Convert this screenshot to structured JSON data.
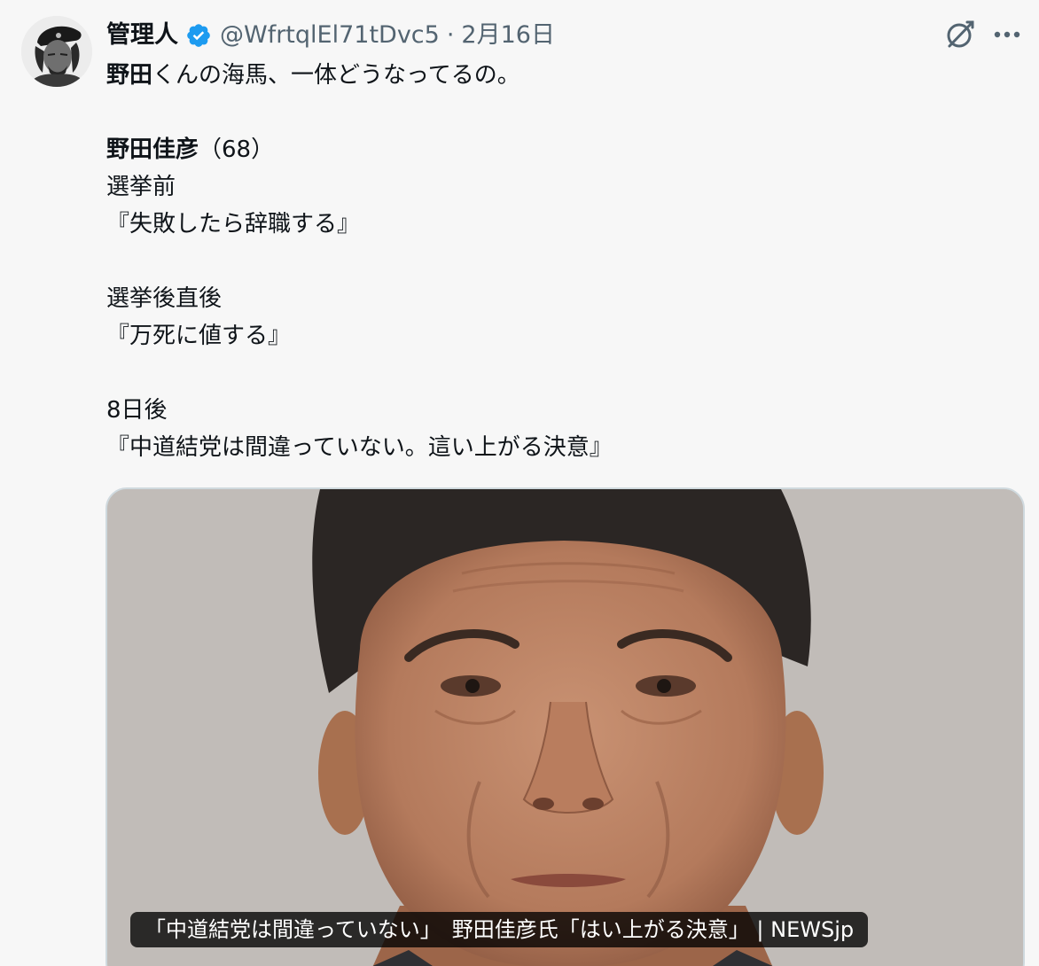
{
  "tweet": {
    "display_name": "管理人",
    "handle": "@WfrtqlEl71tDvc5",
    "separator": "·",
    "date": "2月16日",
    "lines": [
      {
        "text": "",
        "bold": "野田",
        "rest": "くんの海馬、一体どうなってるの。"
      },
      {
        "gap": true
      },
      {
        "bold": "野田佳彦",
        "rest": "（68）"
      },
      {
        "text": "選挙前"
      },
      {
        "text": "『失敗したら辞職する』"
      },
      {
        "gap": true
      },
      {
        "text": "選挙後直後"
      },
      {
        "text": "『万死に値する』"
      },
      {
        "gap": true
      },
      {
        "text": "8日後"
      },
      {
        "text": "『中道結党は間違っていない。這い上がる決意』"
      }
    ],
    "media": {
      "caption": "「中道結党は間違っていない」　野田佳彦氏「はい上がる決意」 | NEWSjp"
    }
  },
  "icons": {
    "avatar": "avatar-portrait",
    "verified": "verified-badge-icon",
    "grok": "grok-icon",
    "more": "more-icon"
  },
  "colors": {
    "background": "#f7f7f7",
    "text": "#0f1419",
    "secondary_text": "#536471",
    "verified": "#1d9bf0"
  }
}
